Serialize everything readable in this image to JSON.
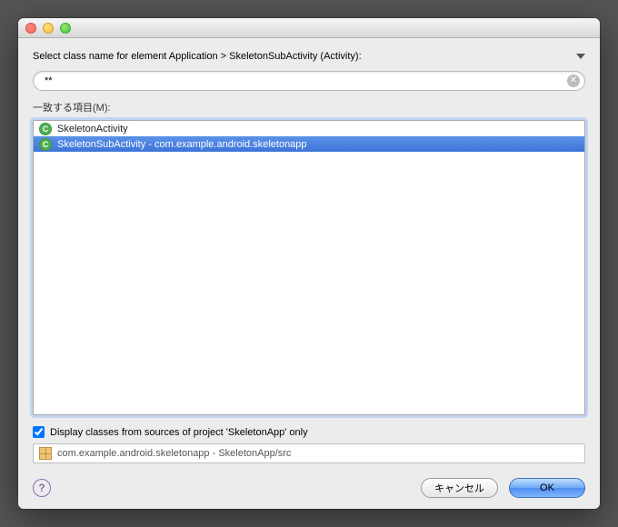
{
  "header": {
    "prompt": "Select class name for element Application > SkeletonSubActivity (Activity):"
  },
  "search": {
    "value": "**"
  },
  "match_label": "一致する項目(M):",
  "items": [
    {
      "label": "SkeletonActivity",
      "selected": false
    },
    {
      "label": "SkeletonSubActivity - com.example.android.skeletonapp",
      "selected": true
    }
  ],
  "checkbox": {
    "label": "Display classes from sources of project 'SkeletonApp' only",
    "checked": true
  },
  "status": {
    "text": "com.example.android.skeletonapp - SkeletonApp/src"
  },
  "buttons": {
    "cancel": "キャンセル",
    "ok": "OK"
  }
}
